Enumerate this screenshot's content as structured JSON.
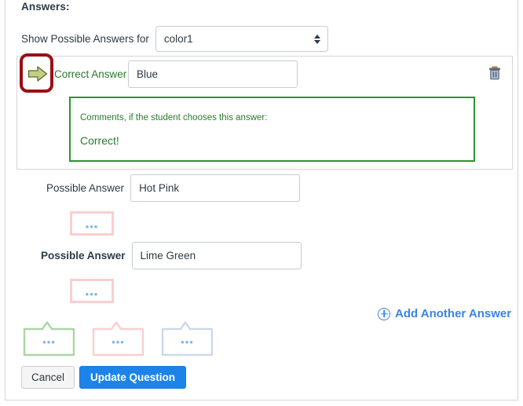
{
  "panel": {
    "answers_heading": "Answers:",
    "show_label": "Show Possible Answers for",
    "select_value": "color1"
  },
  "correct_answer": {
    "arrow_icon": "green-right-arrow-icon",
    "label": "Correct Answer",
    "value": "Blue",
    "delete_icon": "trash-icon",
    "comments_label": "Comments, if the student chooses this answer:",
    "comments_text": "Correct!",
    "highlight_color": "#9a0f14",
    "border_color": "#2e9331",
    "text_color": "#2a7b2e"
  },
  "possible_answers": [
    {
      "label": "Possible Answer",
      "value": "Hot Pink",
      "bold": false
    },
    {
      "label": "Possible Answer",
      "value": "Lime Green",
      "bold": true
    }
  ],
  "mini_boxes": [
    {
      "dots": "•••",
      "border_color": "#f9cfcf"
    },
    {
      "dots": "•••",
      "border_color": "#f9cfcf"
    }
  ],
  "callouts": [
    {
      "dots": "•••",
      "color": "#a9d6a4"
    },
    {
      "dots": "•••",
      "color": "#f9cfcf"
    },
    {
      "dots": "•••",
      "color": "#ccd9ec"
    }
  ],
  "add_answer": {
    "icon": "plus-circle-icon",
    "label": "Add Another Answer",
    "color": "#3a84e6"
  },
  "footer": {
    "cancel_label": "Cancel",
    "update_label": "Update Question",
    "primary_color": "#1c84e8"
  }
}
